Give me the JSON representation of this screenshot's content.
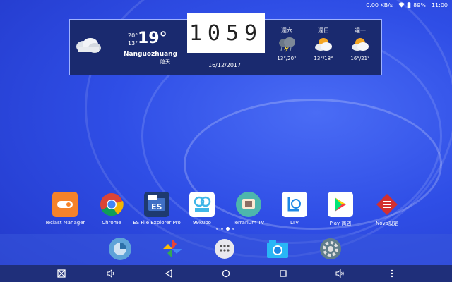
{
  "status_bar": {
    "speed": "0.00 KB/s",
    "battery": "89%",
    "time": "11:00"
  },
  "weather": {
    "temp": "19°",
    "high": "20°",
    "low": "13°",
    "city": "Nanguozhuang",
    "condition": "陰天",
    "clock": "1059",
    "date": "16/12/2017",
    "forecast": [
      {
        "day": "週六",
        "range": "13°/20°",
        "icon": "storm-cloud-icon"
      },
      {
        "day": "週日",
        "range": "13°/18°",
        "icon": "partly-sunny-icon"
      },
      {
        "day": "週一",
        "range": "16°/21°",
        "icon": "partly-sunny-icon"
      }
    ]
  },
  "apps": [
    {
      "label": "Teclast Manager",
      "icon": "teclast-manager-icon",
      "color": "#f5822a"
    },
    {
      "label": "Chrome",
      "icon": "chrome-icon",
      "color": "#ffffff"
    },
    {
      "label": "ES File Explorer Pro",
      "icon": "es-file-explorer-icon",
      "color": "#1e3a70"
    },
    {
      "label": "99kubo",
      "icon": "99kubo-icon",
      "color": "#ffffff"
    },
    {
      "label": "Terrarium TV",
      "icon": "terrarium-tv-icon",
      "color": "#4db6ac"
    },
    {
      "label": "LTV",
      "icon": "ltv-icon",
      "color": "#ffffff"
    },
    {
      "label": "Play 商店",
      "icon": "play-store-icon",
      "color": "#ffffff"
    },
    {
      "label": "Nova設定",
      "icon": "nova-settings-icon",
      "color": "#d32f2f"
    }
  ],
  "clock_digits": [
    "1",
    "0",
    "5",
    "9"
  ]
}
